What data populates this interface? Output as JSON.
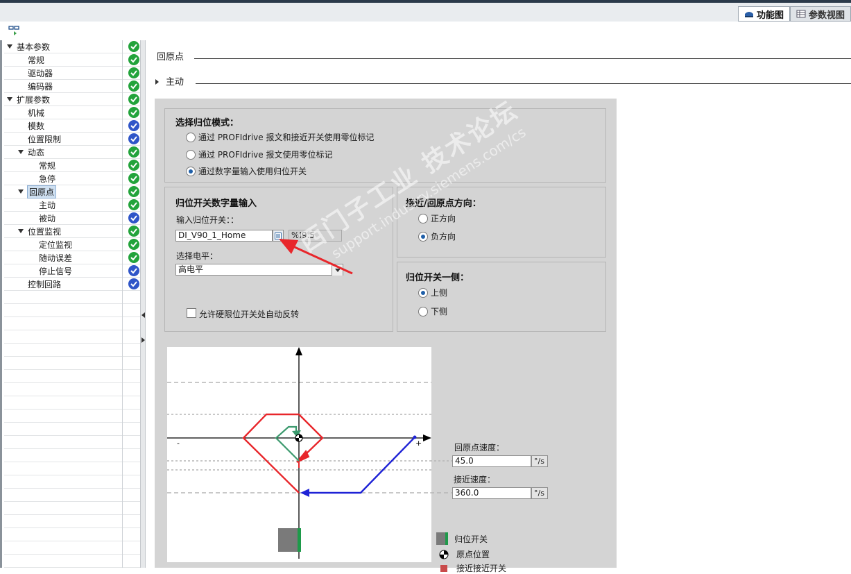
{
  "top_tabs": [
    {
      "label": "功能图",
      "active": true
    },
    {
      "label": "参数视图",
      "active": false
    }
  ],
  "tree": [
    {
      "label": "基本参数",
      "level": 0,
      "expanded": true,
      "status": "ok-green",
      "selected": false
    },
    {
      "label": "常规",
      "level": 1,
      "status": "ok-green",
      "selected": false
    },
    {
      "label": "驱动器",
      "level": 1,
      "status": "ok-green",
      "selected": false
    },
    {
      "label": "编码器",
      "level": 1,
      "status": "ok-green",
      "selected": false
    },
    {
      "label": "扩展参数",
      "level": 0,
      "expanded": true,
      "status": "ok-green",
      "selected": false
    },
    {
      "label": "机械",
      "level": 1,
      "status": "ok-green",
      "selected": false
    },
    {
      "label": "模数",
      "level": 1,
      "status": "ok-blue",
      "selected": false
    },
    {
      "label": "位置限制",
      "level": 1,
      "status": "ok-blue",
      "selected": false
    },
    {
      "label": "动态",
      "level": 1,
      "expanded": true,
      "status": "ok-green",
      "selected": false
    },
    {
      "label": "常规",
      "level": 2,
      "status": "ok-green",
      "selected": false
    },
    {
      "label": "急停",
      "level": 2,
      "status": "ok-green",
      "selected": false
    },
    {
      "label": "回原点",
      "level": 1,
      "expanded": true,
      "status": "ok-green",
      "selected": true
    },
    {
      "label": "主动",
      "level": 2,
      "status": "ok-green",
      "selected": false
    },
    {
      "label": "被动",
      "level": 2,
      "status": "ok-blue",
      "selected": false
    },
    {
      "label": "位置监视",
      "level": 1,
      "expanded": true,
      "status": "ok-green",
      "selected": false
    },
    {
      "label": "定位监视",
      "level": 2,
      "status": "ok-green",
      "selected": false
    },
    {
      "label": "随动误差",
      "level": 2,
      "status": "ok-green",
      "selected": false
    },
    {
      "label": "停止信号",
      "level": 2,
      "status": "ok-blue",
      "selected": false
    },
    {
      "label": "控制回路",
      "level": 1,
      "status": "ok-blue",
      "selected": false
    }
  ],
  "section": {
    "title": "回原点",
    "subtitle": "主动"
  },
  "mode_group": {
    "title": "选择归位模式：",
    "options": [
      {
        "label": "通过 PROFIdrive 报文和接近开关使用零位标记",
        "checked": false
      },
      {
        "label": "通过 PROFIdrive 报文使用零位标记",
        "checked": false
      },
      {
        "label": "通过数字量输入使用归位开关",
        "checked": true
      }
    ]
  },
  "input_group": {
    "title": "归位开关数字量输入",
    "input_label": "输入归位开关：：",
    "input_value": "DI_V90_1_Home",
    "address": "%I9.5",
    "level_label": "选择电平：",
    "level_value": "高电平",
    "reverse_label": "允许硬限位开关处自动反转",
    "reverse_checked": false
  },
  "direction_group": {
    "title": "接近/回原点方向：",
    "options": [
      {
        "label": "正方向",
        "checked": false
      },
      {
        "label": "负方向",
        "checked": true
      }
    ]
  },
  "side_group": {
    "title": "归位开关一侧：",
    "options": [
      {
        "label": "上侧",
        "checked": true
      },
      {
        "label": "下侧",
        "checked": false
      }
    ]
  },
  "speeds": {
    "homing_label": "回原点速度：",
    "homing_value": "45.0",
    "homing_unit": "°/s",
    "approach_label": "接近速度：",
    "approach_value": "360.0",
    "approach_unit": "°/s"
  },
  "diagram": {
    "minus": "-",
    "plus": "+"
  },
  "legend": [
    {
      "label": "归位开关",
      "icon": "home-switch-icon"
    },
    {
      "label": "原点位置",
      "icon": "origin-position-icon"
    },
    {
      "label": "接近接近开关",
      "icon": "approach-switch-icon"
    }
  ],
  "watermark": {
    "line1": "西门子工业 技术论坛",
    "line2": "support.industry.siemens.com/cs"
  },
  "colors": {
    "ok_green": "#22a33b",
    "ok_blue": "#2f55c8",
    "panel_bg": "#d4d4d4",
    "red": "#e8262b",
    "green_path": "#3c9a6e",
    "blue_path": "#1e22d6"
  }
}
